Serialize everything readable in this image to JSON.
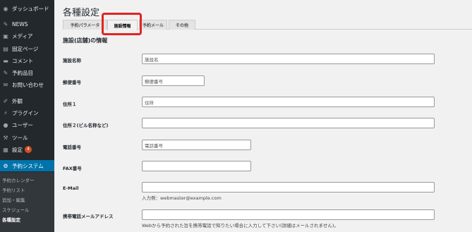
{
  "sidebar": {
    "items": [
      {
        "label": "ダッシュボード",
        "icon": "dashboard-icon"
      },
      {
        "label": "NEWS",
        "icon": "pin-icon"
      },
      {
        "label": "メディア",
        "icon": "media-icon"
      },
      {
        "label": "固定ページ",
        "icon": "page-icon"
      },
      {
        "label": "コメント",
        "icon": "comment-icon"
      },
      {
        "label": "予約品目",
        "icon": "pin-icon"
      },
      {
        "label": "お問い合わせ",
        "icon": "mail-icon"
      },
      {
        "label": "外観",
        "icon": "appearance-icon"
      },
      {
        "label": "プラグイン",
        "icon": "plugin-icon"
      },
      {
        "label": "ユーザー",
        "icon": "user-icon"
      },
      {
        "label": "ツール",
        "icon": "tool-icon"
      },
      {
        "label": "設定",
        "icon": "settings-icon",
        "badge": "4"
      },
      {
        "label": "予約システム",
        "icon": "gear-icon"
      }
    ],
    "submenu": [
      "予約カレンダー",
      "予約リスト",
      "追加・編集",
      "スケジュール",
      "各種設定"
    ]
  },
  "page": {
    "title": "各種設定",
    "tabs": [
      "予約パラメータ",
      "施設情報",
      "予約メール",
      "その他"
    ],
    "section_title": "施設(店舗)の情報"
  },
  "form": {
    "name": {
      "label": "施設名称",
      "value": "施設名"
    },
    "postal": {
      "label": "郵便番号",
      "value": "郵便番号"
    },
    "address1": {
      "label": "住所１",
      "value": "住所"
    },
    "address2": {
      "label": "住所２(ビル名称など)",
      "value": ""
    },
    "phone": {
      "label": "電話番号",
      "value": "電話番号"
    },
    "fax": {
      "label": "FAX番号",
      "value": ""
    },
    "email": {
      "label": "E-Mail",
      "value": "",
      "hint": "入力例：webmaster@example.com"
    },
    "mobile_email": {
      "label": "携帯電話メールアドレス",
      "value": "",
      "hint": "Webから予約された旨を携帯電話で知りたい場合に入力して下さい(詳細はメールされません)。"
    }
  },
  "colors": {
    "highlight": "#e12424",
    "active_menu": "#0073aa",
    "badge": "#d54e21"
  }
}
